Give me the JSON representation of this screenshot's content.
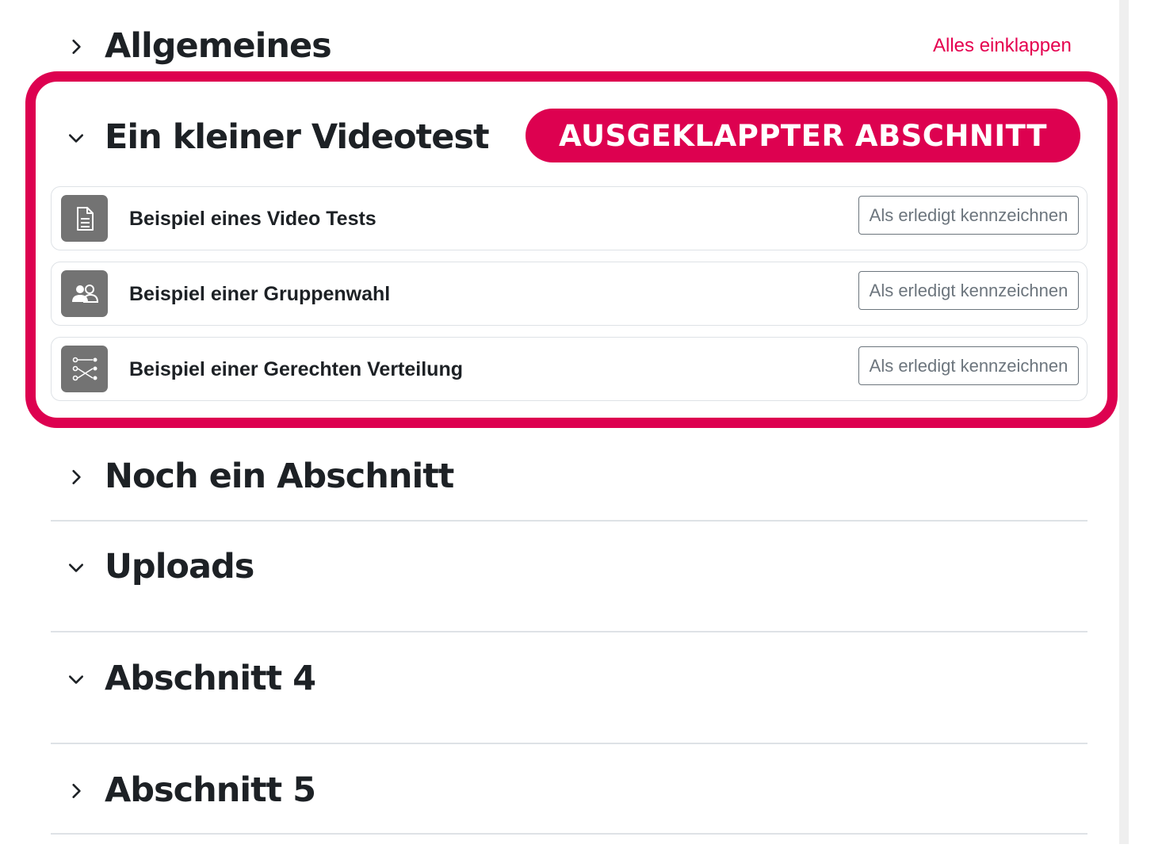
{
  "collapse_all_label": "Alles einklappen",
  "highlight_badge": "AUSGEKLAPPTER ABSCHNITT",
  "accent_color": "#dd0150",
  "sections": [
    {
      "title": "Allgemeines",
      "state": "collapsed"
    },
    {
      "title": "Ein kleiner Videotest",
      "state": "expanded"
    },
    {
      "title": "Noch ein Abschnitt",
      "state": "collapsed"
    },
    {
      "title": "Uploads",
      "state": "expanded"
    },
    {
      "title": "Abschnitt 4",
      "state": "expanded"
    },
    {
      "title": "Abschnitt 5",
      "state": "collapsed"
    }
  ],
  "activities": [
    {
      "name": "Beispiel eines Video Tests",
      "icon": "document-icon",
      "button": "Als erledigt kennzeichnen"
    },
    {
      "name": "Beispiel einer Gruppenwahl",
      "icon": "group-choice-icon",
      "button": "Als erledigt kennzeichnen"
    },
    {
      "name": "Beispiel einer Gerechten Verteilung",
      "icon": "ratings-allocation-icon",
      "button": "Als erledigt kennzeichnen"
    }
  ]
}
